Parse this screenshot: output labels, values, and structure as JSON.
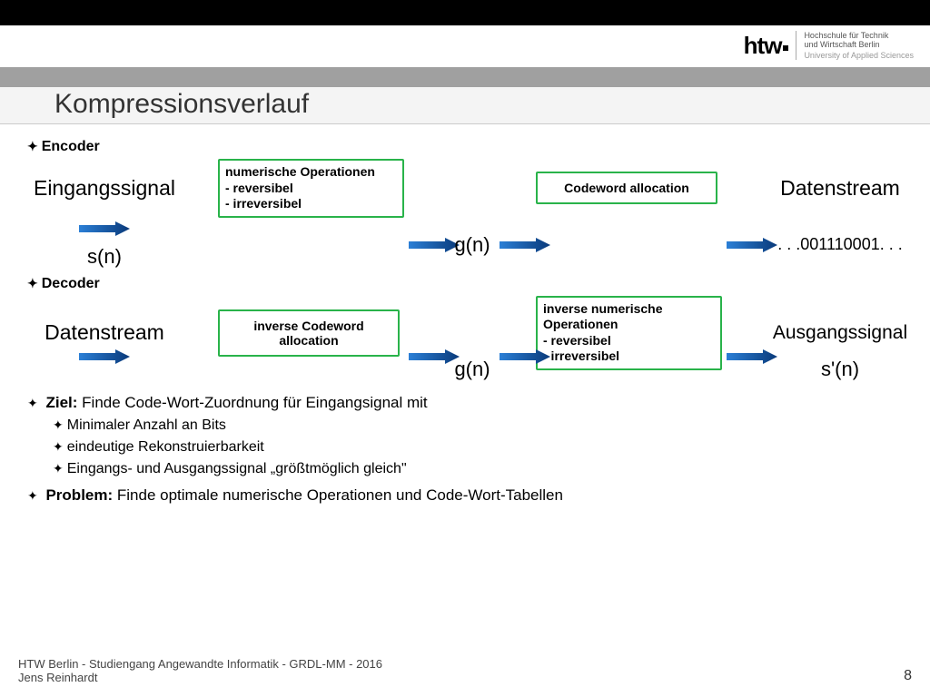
{
  "logo": {
    "mark": "htw",
    "line1": "Hochschule für Technik",
    "line2": "und Wirtschaft Berlin",
    "line3": "University of Applied Sciences"
  },
  "title": "Kompressionsverlauf",
  "encoder": {
    "heading": "Encoder",
    "input_label": "Eingangssignal",
    "input_fn": "s(n)",
    "box1_l1": "numerische Operationen",
    "box1_l2": "- reversibel",
    "box1_l3": "- irreversibel",
    "mid_fn": "g(n)",
    "box2": "Codeword allocation",
    "out_label": "Datenstream",
    "out_fn": ". . .001110001. . ."
  },
  "decoder": {
    "heading": "Decoder",
    "input_label": "Datenstream",
    "box1": "inverse Codeword allocation",
    "mid_fn": "g(n)",
    "box2_l1": "inverse numerische",
    "box2_l2": "Operationen",
    "box2_l3": "- reversibel",
    "box2_l4": "- irreversibel",
    "out_label": "Ausgangssignal",
    "out_fn": "s'(n)"
  },
  "goals": {
    "ziel_label": "Ziel:",
    "ziel_text": "Finde Code-Wort-Zuordnung für Eingangsignal mit",
    "sub1": "Minimaler Anzahl an Bits",
    "sub2": "eindeutige Rekonstruierbarkeit",
    "sub3": "Eingangs- und Ausgangssignal „größtmöglich gleich\"",
    "problem_label": "Problem:",
    "problem_text": "Finde optimale numerische Operationen und Code-Wort-Tabellen"
  },
  "footer": {
    "left_l1": "HTW Berlin - Studiengang Angewandte Informatik - GRDL-MM - 2016",
    "left_l2": "Jens Reinhardt",
    "page": "8"
  }
}
